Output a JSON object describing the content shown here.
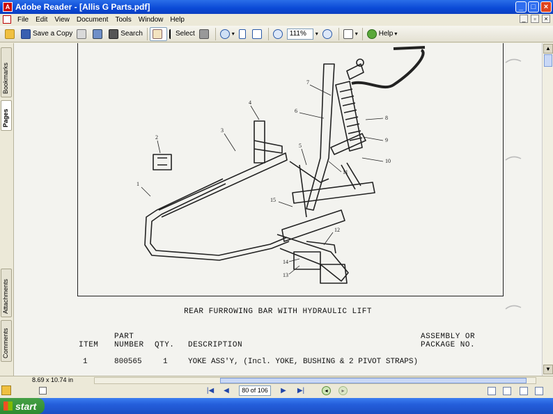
{
  "window": {
    "title": "Adobe Reader - [Allis G Parts.pdf]",
    "app_icon": "pdf-icon",
    "controls": {
      "minimize": "_",
      "maximize": "□",
      "close": "×"
    }
  },
  "menu": {
    "items": [
      "File",
      "Edit",
      "View",
      "Document",
      "Tools",
      "Window",
      "Help"
    ],
    "window_controls": {
      "minimize": "_",
      "restore": "▫",
      "close": "×"
    }
  },
  "toolbar": {
    "save_copy_label": "Save a Copy",
    "search_label": "Search",
    "select_label": "Select",
    "zoom_value": "111%",
    "help_label": "Help"
  },
  "side_tabs": {
    "bookmarks": "Bookmarks",
    "pages": "Pages",
    "attachments": "Attachments",
    "comments": "Comments"
  },
  "document": {
    "caption": "REAR FURROWING BAR WITH HYDRAULIC LIFT",
    "callouts": [
      "1",
      "2",
      "3",
      "4",
      "5",
      "6",
      "7",
      "8",
      "9",
      "10",
      "11",
      "12",
      "13",
      "14",
      "15"
    ],
    "table": {
      "headers": {
        "item": "ITEM",
        "part_top": "PART",
        "part_bottom": "NUMBER",
        "qty": "QTY.",
        "description": "DESCRIPTION",
        "assembly_top": "ASSEMBLY OR",
        "assembly_bottom": "PACKAGE NO."
      },
      "rows": [
        {
          "item": "1",
          "part": "800565",
          "qty": "1",
          "description": "YOKE ASS'Y, (Incl. YOKE, BUSHING & 2 PIVOT STRAPS)"
        }
      ]
    }
  },
  "status": {
    "page_size": "8.69 x 10.74 in",
    "page_indicator": "80 of 106"
  },
  "taskbar": {
    "start_label": "start"
  }
}
